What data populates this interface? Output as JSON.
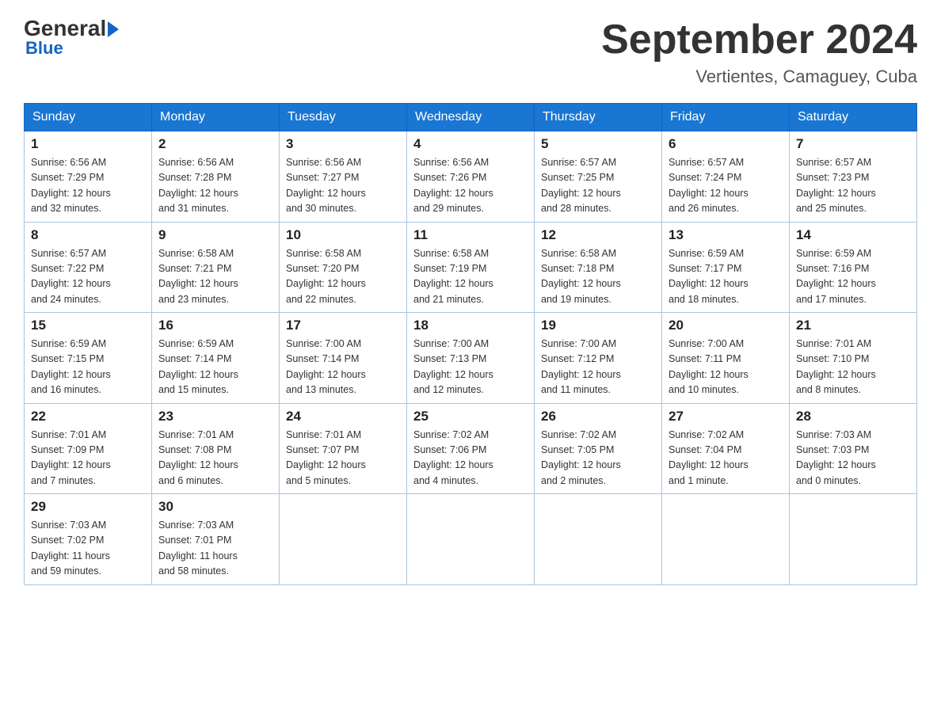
{
  "logo": {
    "general": "General",
    "blue": "Blue",
    "arrow": "▶"
  },
  "title": "September 2024",
  "location": "Vertientes, Camaguey, Cuba",
  "weekdays": [
    "Sunday",
    "Monday",
    "Tuesday",
    "Wednesday",
    "Thursday",
    "Friday",
    "Saturday"
  ],
  "weeks": [
    [
      {
        "day": "1",
        "sunrise": "6:56 AM",
        "sunset": "7:29 PM",
        "daylight": "12 hours and 32 minutes."
      },
      {
        "day": "2",
        "sunrise": "6:56 AM",
        "sunset": "7:28 PM",
        "daylight": "12 hours and 31 minutes."
      },
      {
        "day": "3",
        "sunrise": "6:56 AM",
        "sunset": "7:27 PM",
        "daylight": "12 hours and 30 minutes."
      },
      {
        "day": "4",
        "sunrise": "6:56 AM",
        "sunset": "7:26 PM",
        "daylight": "12 hours and 29 minutes."
      },
      {
        "day": "5",
        "sunrise": "6:57 AM",
        "sunset": "7:25 PM",
        "daylight": "12 hours and 28 minutes."
      },
      {
        "day": "6",
        "sunrise": "6:57 AM",
        "sunset": "7:24 PM",
        "daylight": "12 hours and 26 minutes."
      },
      {
        "day": "7",
        "sunrise": "6:57 AM",
        "sunset": "7:23 PM",
        "daylight": "12 hours and 25 minutes."
      }
    ],
    [
      {
        "day": "8",
        "sunrise": "6:57 AM",
        "sunset": "7:22 PM",
        "daylight": "12 hours and 24 minutes."
      },
      {
        "day": "9",
        "sunrise": "6:58 AM",
        "sunset": "7:21 PM",
        "daylight": "12 hours and 23 minutes."
      },
      {
        "day": "10",
        "sunrise": "6:58 AM",
        "sunset": "7:20 PM",
        "daylight": "12 hours and 22 minutes."
      },
      {
        "day": "11",
        "sunrise": "6:58 AM",
        "sunset": "7:19 PM",
        "daylight": "12 hours and 21 minutes."
      },
      {
        "day": "12",
        "sunrise": "6:58 AM",
        "sunset": "7:18 PM",
        "daylight": "12 hours and 19 minutes."
      },
      {
        "day": "13",
        "sunrise": "6:59 AM",
        "sunset": "7:17 PM",
        "daylight": "12 hours and 18 minutes."
      },
      {
        "day": "14",
        "sunrise": "6:59 AM",
        "sunset": "7:16 PM",
        "daylight": "12 hours and 17 minutes."
      }
    ],
    [
      {
        "day": "15",
        "sunrise": "6:59 AM",
        "sunset": "7:15 PM",
        "daylight": "12 hours and 16 minutes."
      },
      {
        "day": "16",
        "sunrise": "6:59 AM",
        "sunset": "7:14 PM",
        "daylight": "12 hours and 15 minutes."
      },
      {
        "day": "17",
        "sunrise": "7:00 AM",
        "sunset": "7:14 PM",
        "daylight": "12 hours and 13 minutes."
      },
      {
        "day": "18",
        "sunrise": "7:00 AM",
        "sunset": "7:13 PM",
        "daylight": "12 hours and 12 minutes."
      },
      {
        "day": "19",
        "sunrise": "7:00 AM",
        "sunset": "7:12 PM",
        "daylight": "12 hours and 11 minutes."
      },
      {
        "day": "20",
        "sunrise": "7:00 AM",
        "sunset": "7:11 PM",
        "daylight": "12 hours and 10 minutes."
      },
      {
        "day": "21",
        "sunrise": "7:01 AM",
        "sunset": "7:10 PM",
        "daylight": "12 hours and 8 minutes."
      }
    ],
    [
      {
        "day": "22",
        "sunrise": "7:01 AM",
        "sunset": "7:09 PM",
        "daylight": "12 hours and 7 minutes."
      },
      {
        "day": "23",
        "sunrise": "7:01 AM",
        "sunset": "7:08 PM",
        "daylight": "12 hours and 6 minutes."
      },
      {
        "day": "24",
        "sunrise": "7:01 AM",
        "sunset": "7:07 PM",
        "daylight": "12 hours and 5 minutes."
      },
      {
        "day": "25",
        "sunrise": "7:02 AM",
        "sunset": "7:06 PM",
        "daylight": "12 hours and 4 minutes."
      },
      {
        "day": "26",
        "sunrise": "7:02 AM",
        "sunset": "7:05 PM",
        "daylight": "12 hours and 2 minutes."
      },
      {
        "day": "27",
        "sunrise": "7:02 AM",
        "sunset": "7:04 PM",
        "daylight": "12 hours and 1 minute."
      },
      {
        "day": "28",
        "sunrise": "7:03 AM",
        "sunset": "7:03 PM",
        "daylight": "12 hours and 0 minutes."
      }
    ],
    [
      {
        "day": "29",
        "sunrise": "7:03 AM",
        "sunset": "7:02 PM",
        "daylight": "11 hours and 59 minutes."
      },
      {
        "day": "30",
        "sunrise": "7:03 AM",
        "sunset": "7:01 PM",
        "daylight": "11 hours and 58 minutes."
      },
      null,
      null,
      null,
      null,
      null
    ]
  ],
  "labels": {
    "sunrise": "Sunrise:",
    "sunset": "Sunset:",
    "daylight": "Daylight:"
  }
}
